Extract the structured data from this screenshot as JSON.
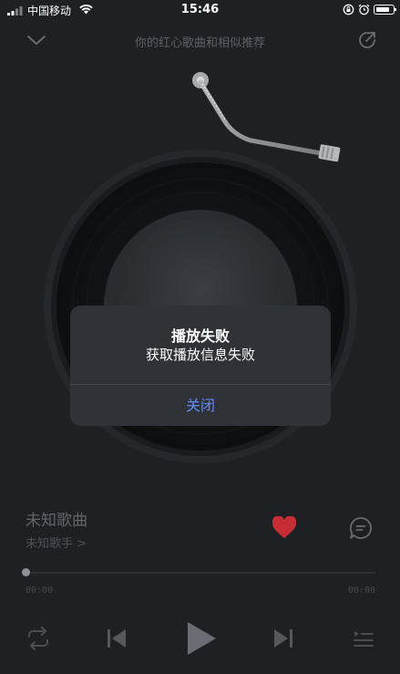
{
  "status_bar": {
    "carrier": "中国移动",
    "time": "15:46"
  },
  "nav": {
    "title": "你的红心歌曲和相似推荐"
  },
  "dialog": {
    "title": "播放失败",
    "message": "获取播放信息失败",
    "close_label": "关闭"
  },
  "song": {
    "title": "未知歌曲",
    "artist": "未知歌手 >"
  },
  "progress": {
    "elapsed": "00:00",
    "total": "00:00",
    "fraction": 0
  },
  "colors": {
    "background": "#1f2024",
    "accent_blue": "#5a8cff",
    "heart_red": "#c62d35"
  },
  "icons": {
    "collapse": "chevron-down-icon",
    "share": "share-icon",
    "like": "heart-icon",
    "comment": "comment-icon",
    "repeat": "repeat-icon",
    "previous": "previous-icon",
    "play": "play-icon",
    "next": "next-icon",
    "playlist": "playlist-icon"
  }
}
